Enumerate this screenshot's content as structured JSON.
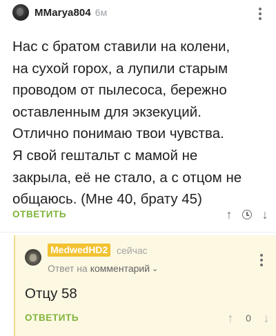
{
  "comment": {
    "username": "MMarya804",
    "time": "6м",
    "text": "Нас с братом ставили на колени,\nна сухой горох, а лупили старым\nпроводом от пылесоса, бережно\nоставленным для экзекуций.\nОтлично понимаю твои чувства.\nЯ свой гештальт с мамой не\nзакрыла, её не стало, а с отцом не\nобщаюсь. (Мне 40, брату 45)",
    "reply_label": "ОТВЕТИТЬ",
    "upvote_icon": "↑",
    "downvote_icon": "↓"
  },
  "reply": {
    "username": "MedwedHD2",
    "time": "сейчас",
    "reply_to_prefix": "Ответ на",
    "reply_to_target": "комментарий",
    "chevron": "⌄",
    "text": "Отцу 58",
    "reply_label": "ОТВЕТИТЬ",
    "upvote_icon": "↑",
    "score": "0",
    "downvote_icon": "↓"
  },
  "colors": {
    "accent_green": "#7fb33a",
    "badge_yellow": "#f2c232",
    "reply_bg": "#fdf8e2"
  }
}
